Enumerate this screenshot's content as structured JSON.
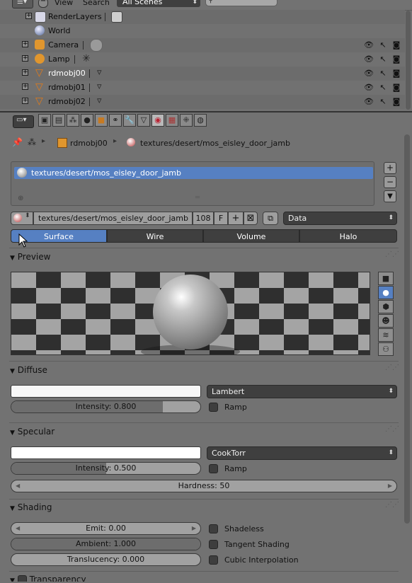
{
  "outliner": {
    "menu": {
      "view": "View",
      "search": "Search"
    },
    "scene_selector": "All Scenes",
    "search_placeholder": "",
    "rows": [
      {
        "label": "RenderLayers"
      },
      {
        "label": "World"
      },
      {
        "label": "Camera"
      },
      {
        "label": "Lamp"
      },
      {
        "label": "rdmobj00"
      },
      {
        "label": "rdmobj01"
      },
      {
        "label": "rdmobj02"
      }
    ]
  },
  "properties": {
    "breadcrumb": {
      "object": "rdmobj00",
      "material": "textures/desert/mos_eisley_door_jamb"
    },
    "material_slots": [
      "textures/desert/mos_eisley_door_jamb"
    ],
    "material_name": "textures/desert/mos_eisley_door_jamb",
    "users_count": "108",
    "fake_user": "F",
    "link_dropdown": "Data",
    "mode_tabs": [
      "Surface",
      "Wire",
      "Volume",
      "Halo"
    ],
    "active_mode": "Surface",
    "panels": {
      "preview": {
        "title": "Preview"
      },
      "diffuse": {
        "title": "Diffuse",
        "shader": "Lambert",
        "intensity_label": "Intensity: 0.800",
        "intensity_value": 0.8,
        "ramp_label": "Ramp",
        "color": "#f7f7f7"
      },
      "specular": {
        "title": "Specular",
        "shader": "CookTorr",
        "intensity_label": "Intensity: 0.500",
        "intensity_value": 0.5,
        "ramp_label": "Ramp",
        "hardness_label": "Hardness: 50",
        "color": "#ffffff"
      },
      "shading": {
        "title": "Shading",
        "emit_label": "Emit: 0.00",
        "ambient_label": "Ambient: 1.000",
        "translucency_label": "Translucency: 0.000",
        "shadeless_label": "Shadeless",
        "tangent_label": "Tangent Shading",
        "cubic_label": "Cubic Interpolation"
      },
      "transparency": {
        "title": "Transparency"
      }
    }
  },
  "colors": {
    "accent": "#5680c2",
    "panel_bg": "#727272",
    "dark_widget": "#3f3f3f"
  }
}
